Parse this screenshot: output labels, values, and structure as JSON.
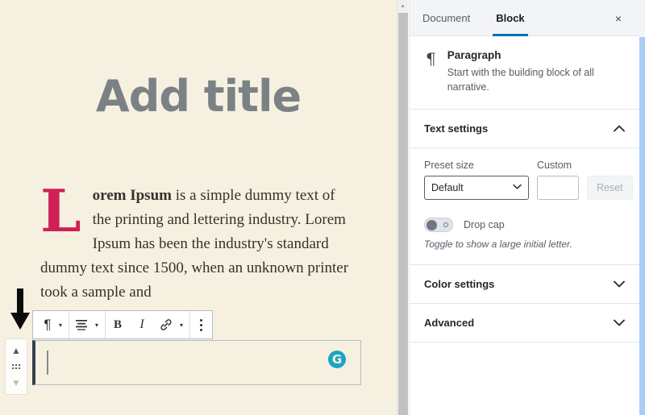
{
  "editor": {
    "title_placeholder": "Add title",
    "paragraph": {
      "dropcap": "L",
      "lead": "orem Ipsum",
      "rest": " is a simple dummy text of the printing and lettering industry. Lorem Ipsum has been the industry's standard dummy text since 1500, when an unknown printer took a sample and",
      "dropcap_color": "#cf2155"
    },
    "canvas_bg": "#f6f0e1"
  },
  "annotation": {
    "arrow": "down-arrow"
  },
  "mover": {
    "up_label": "Move up",
    "drag_label": "Drag block",
    "down_label": "Move down"
  },
  "toolbar": {
    "block_type_icon": "¶",
    "block_type_caret": "▾",
    "align_icon": "align-lines",
    "align_caret": "▾",
    "bold_label": "B",
    "italic_label": "I",
    "link_icon": "link",
    "more_rich_caret": "▾",
    "options_icon": "three-dots"
  },
  "selected_block": {
    "caret": "",
    "grammarly_letter": "G",
    "grammarly_color": "#18a6c4"
  },
  "sidebar": {
    "tabs": [
      {
        "label": "Document",
        "active": false
      },
      {
        "label": "Block",
        "active": true
      }
    ],
    "close_icon": "×",
    "active_underline_color": "#0073aa",
    "block_card": {
      "icon": "¶",
      "title": "Paragraph",
      "description": "Start with the building block of all narrative."
    },
    "panels": [
      {
        "title": "Text settings",
        "chevron": "⌃",
        "expanded": true
      },
      {
        "title": "Color settings",
        "chevron": "⌄",
        "expanded": false
      },
      {
        "title": "Advanced",
        "chevron": "⌄",
        "expanded": false
      }
    ],
    "text_settings": {
      "preset_label": "Preset size",
      "preset_value": "Default",
      "preset_caret": "⌄",
      "custom_label": "Custom",
      "custom_value": "",
      "custom_placeholder": "",
      "reset_label": "Reset",
      "dropcap_label": "Drop cap",
      "dropcap_state": "off",
      "dropcap_help": "Toggle to show a large initial letter."
    }
  },
  "scrollbars": {
    "canvas_up_arrow": "▴"
  }
}
